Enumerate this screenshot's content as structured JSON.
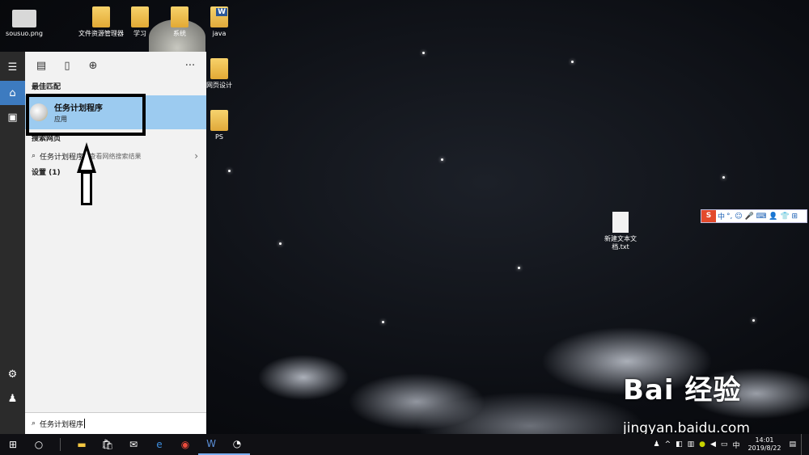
{
  "desktop": {
    "icons": [
      {
        "label": "sousuo.png"
      },
      {
        "label": "文件资源管理器"
      },
      {
        "label": "学习"
      },
      {
        "label": "系统"
      },
      {
        "label": "java"
      },
      {
        "label": "网页设计"
      },
      {
        "label": "PS"
      },
      {
        "label": "新建文本文档.txt"
      }
    ]
  },
  "start_menu": {
    "top_icons": [
      "apps-icon",
      "document-icon",
      "web-icon"
    ],
    "more": "···",
    "best_match_header": "最佳匹配",
    "best_match": {
      "title": "任务计划程序",
      "subtitle": "应用"
    },
    "web_header": "搜索网页",
    "web_query": "任务计划程序",
    "web_hint": "- 查看网络搜索结果",
    "settings_header": "设置 (1)",
    "search_value": "任务计划程序"
  },
  "ime_toolbar": {
    "logo": "S",
    "mode": "中",
    "items": "°, ☺ 🎤 ⌨ 👤 👕 ⊞"
  },
  "watermark": {
    "brand": "Bai 经验",
    "url": "jingyan.baidu.com"
  },
  "taskbar": {
    "clock_time": "14:01",
    "clock_date": "2019/8/22"
  },
  "colors": {
    "accent": "#3d7bc0",
    "selection": "#9ccbf0",
    "taskbar": "#101014"
  }
}
